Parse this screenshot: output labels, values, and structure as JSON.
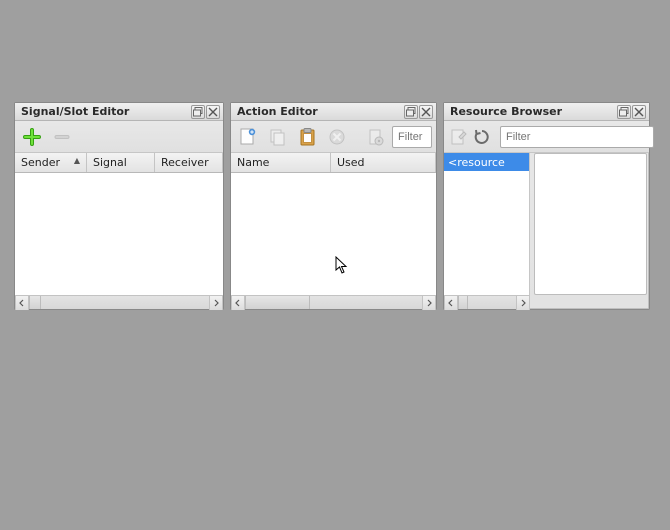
{
  "signal_slot_editor": {
    "title": "Signal/Slot Editor",
    "columns": {
      "sender": "Sender",
      "signal": "Signal",
      "receiver": "Receiver"
    }
  },
  "action_editor": {
    "title": "Action Editor",
    "filter_placeholder": "Filter",
    "columns": {
      "name": "Name",
      "used": "Used"
    }
  },
  "resource_browser": {
    "title": "Resource Browser",
    "filter_placeholder": "Filter",
    "root_item": "<resource"
  },
  "icons": {
    "plus": "plus-icon",
    "minus": "minus-icon",
    "new": "new-action-icon",
    "copy": "copy-icon",
    "paste": "paste-icon",
    "delete": "delete-circle-icon",
    "config": "configure-icon",
    "edit_res": "edit-resources-icon",
    "reload": "reload-icon",
    "restore": "restore-window-icon",
    "close": "close-window-icon",
    "scroll_left": "scroll-left-icon",
    "scroll_right": "scroll-right-icon"
  },
  "colors": {
    "selection": "#3d8be8",
    "workspace_bg": "#9f9f9f",
    "panel_bg": "#e4e4e4"
  }
}
